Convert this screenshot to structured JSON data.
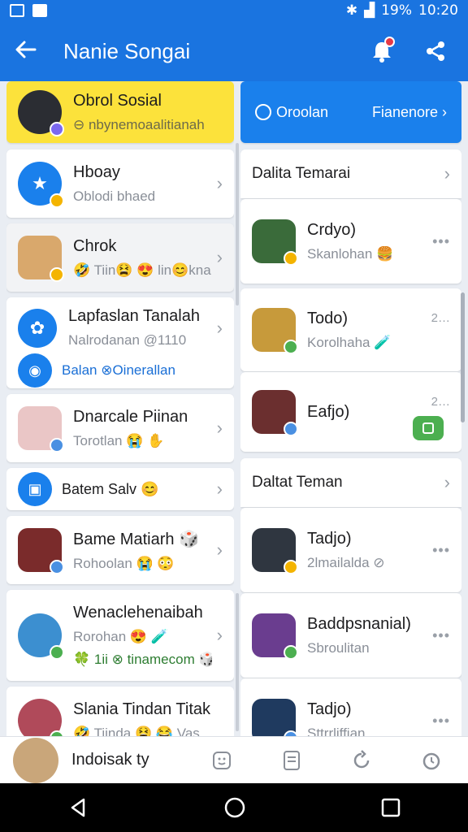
{
  "status_bar": {
    "battery": "19%",
    "time": "10:20"
  },
  "app_bar": {
    "title": "Nanie Songai",
    "back_icon": "arrow-left-icon",
    "notif_icon": "bell-icon",
    "share_icon": "share-icon"
  },
  "left": {
    "header": {
      "name": "Obrol Sosial",
      "sub": "⊖ nbynemoaalitianah"
    },
    "items": [
      {
        "name": "Hboay",
        "sub": "Oblodi bhaed"
      },
      {
        "name": "Chrok",
        "sub": "🤣 Tiin😫 😍 lin😊kna😈"
      },
      {
        "name": "Lapfaslan Tanalah",
        "sub": "Nalrodanan @1110",
        "link": "Balan ⊗Oinerallan"
      },
      {
        "name": "Dnarcale Piinan",
        "sub": "Torotlan 😭 ✋"
      },
      {
        "name": "Batem Salv 😊"
      },
      {
        "name": "Bame Matiarh 🎲",
        "sub": "Rohoolan 😭 😳"
      },
      {
        "name": "Wenaclehenaibah",
        "sub": "Rorohan 😍 🧪",
        "sub2": "🍀 1ii ⊗ tinamecom 🎲"
      },
      {
        "name": "Slania Tindan Titak",
        "sub": "🤣 Tiinda 😫 😂 Vas"
      }
    ]
  },
  "right": {
    "header": {
      "left": "Oroolan",
      "right": "Fianenore ›"
    },
    "section1": "Dalita Temarai",
    "items1": [
      {
        "name": "Crdyo)",
        "sub": "Skanlohan 🍔"
      },
      {
        "name": "Todo)",
        "sub": "Korolhaha 🧪",
        "time": "2…"
      },
      {
        "name": "Eafjo)",
        "sub": "",
        "time": "2…"
      }
    ],
    "section2": "Daltat Teman",
    "items2": [
      {
        "name": "Tadjo)",
        "sub": "2lmailalda ⊘"
      },
      {
        "name": "Baddpsnanial)",
        "sub": "Sbroulitan"
      },
      {
        "name": "Tadjo)",
        "sub": "Sttrrliffian"
      }
    ]
  },
  "bottom_bar": {
    "me_label": "Indoisak ty",
    "icons": [
      "face-icon",
      "note-icon",
      "refresh-icon",
      "clock-icon"
    ]
  },
  "colors": {
    "primary": "#1a74e0",
    "yellow": "#fce23b",
    "green": "#4caf50"
  }
}
